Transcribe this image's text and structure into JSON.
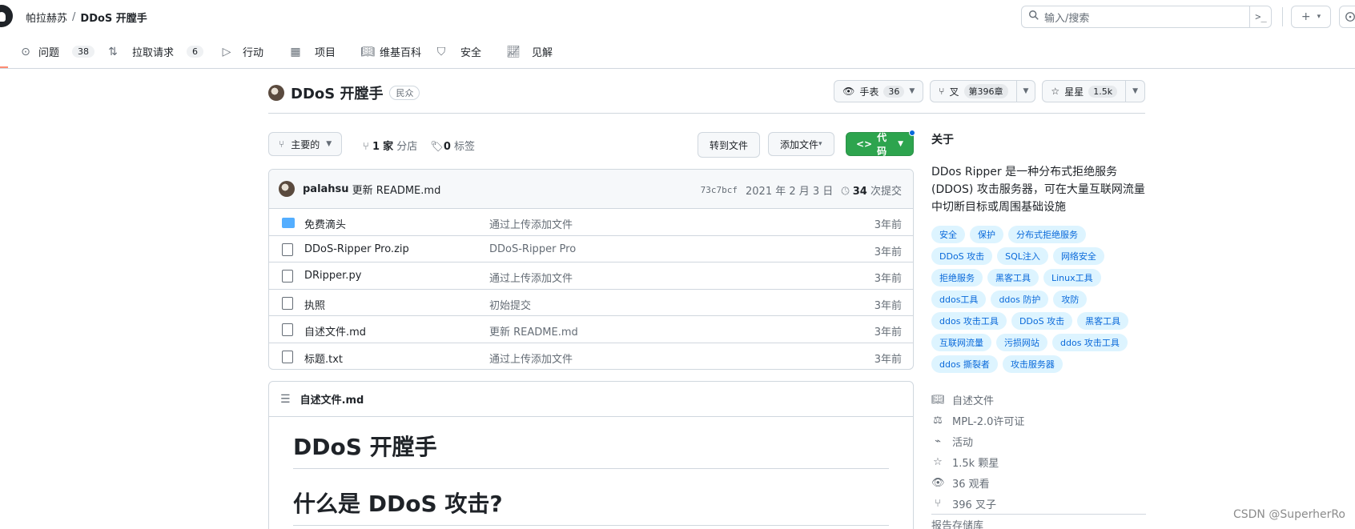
{
  "breadcrumbs": {
    "owner": "帕拉赫苏",
    "separator": "/",
    "repo": "DDoS 开膛手"
  },
  "search": {
    "placeholder": "输入/搜索",
    "shortcut": ">_"
  },
  "topbar": {
    "plus": "+",
    "plus_caret": "▾"
  },
  "tabs": [
    {
      "label": "问题",
      "count": "38",
      "icon": "issue-icon"
    },
    {
      "label": "拉取请求",
      "count": "6",
      "icon": "pull-request-icon"
    },
    {
      "label": "行动",
      "icon": "actions-icon"
    },
    {
      "label": "项目",
      "icon": "table-icon"
    },
    {
      "label": "维基百科",
      "icon": "book-icon"
    },
    {
      "label": "安全",
      "icon": "shield-icon"
    },
    {
      "label": "见解",
      "icon": "graph-icon"
    }
  ],
  "repo": {
    "name": "DDoS 开膛手",
    "visibility": "民众",
    "watch_label": "手表",
    "watch_count": "36",
    "fork_label": "叉",
    "fork_count": "第396章",
    "star_label": "星星",
    "star_count": "1.5k"
  },
  "toolbar": {
    "branch": "主要的",
    "branch_count": "1",
    "branch_label": "家",
    "branch_suffix": "分店",
    "tag_count": "0",
    "tag_label": "标签",
    "goto_file": "转到文件",
    "add_file": "添加文件",
    "code": "代码"
  },
  "commit": {
    "author": "palahsu",
    "message": "更新 README.md",
    "sha": "73c7bcf",
    "date": "2021 年 2 月 3 日",
    "count": "34",
    "count_label": "次提交"
  },
  "files": [
    {
      "name": "免费滴头",
      "message": "通过上传添加文件",
      "age": "3年前",
      "type": "folder"
    },
    {
      "name": "DDoS-Ripper Pro.zip",
      "message": "DDoS-Ripper Pro",
      "age": "3年前",
      "type": "file"
    },
    {
      "name": "DRipper.py",
      "message": "通过上传添加文件",
      "age": "3年前",
      "type": "file"
    },
    {
      "name": "执照",
      "message": "初始提交",
      "age": "3年前",
      "type": "file"
    },
    {
      "name": "自述文件.md",
      "message": "更新 README.md",
      "age": "3年前",
      "type": "file"
    },
    {
      "name": "标题.txt",
      "message": "通过上传添加文件",
      "age": "3年前",
      "type": "file"
    }
  ],
  "readme": {
    "title": "自述文件.md",
    "h1": "DDoS 开膛手",
    "h2": "什么是 DDoS 攻击?"
  },
  "about": {
    "heading": "关于",
    "description": "DDos Ripper 是一种分布式拒绝服务 (DDOS) 攻击服务器，可在大量互联网流量中切断目标或周围基础设施",
    "topics": [
      "安全",
      "保护",
      "分布式拒绝服务",
      "DDoS 攻击",
      "SQL注入",
      "网络安全",
      "拒绝服务",
      "黑客工具",
      "Linux工具",
      "ddos工具",
      "ddos 防护",
      "攻防",
      "ddos 攻击工具",
      "DDoS 攻击",
      "黑客工具",
      "互联网流量",
      "污损网站",
      "ddos 攻击工具",
      "ddos 撕裂者",
      "攻击服务器"
    ],
    "meta": [
      {
        "label": "自述文件",
        "icon": "book-icon"
      },
      {
        "label": "MPL-2.0许可证",
        "icon": "law-icon"
      },
      {
        "label": "活动",
        "icon": "pulse-icon"
      },
      {
        "label": "1.5k 颗星",
        "icon": "star-icon"
      },
      {
        "label": "36 观看",
        "icon": "eye-icon"
      },
      {
        "label": "396 叉子",
        "icon": "fork-icon"
      }
    ],
    "report": "报告存储库"
  },
  "watermark": "CSDN @SuperherRo",
  "colors": {
    "accent_green": "#2da44e",
    "link_blue": "#0969da",
    "topic_bg": "#ddf4ff"
  }
}
